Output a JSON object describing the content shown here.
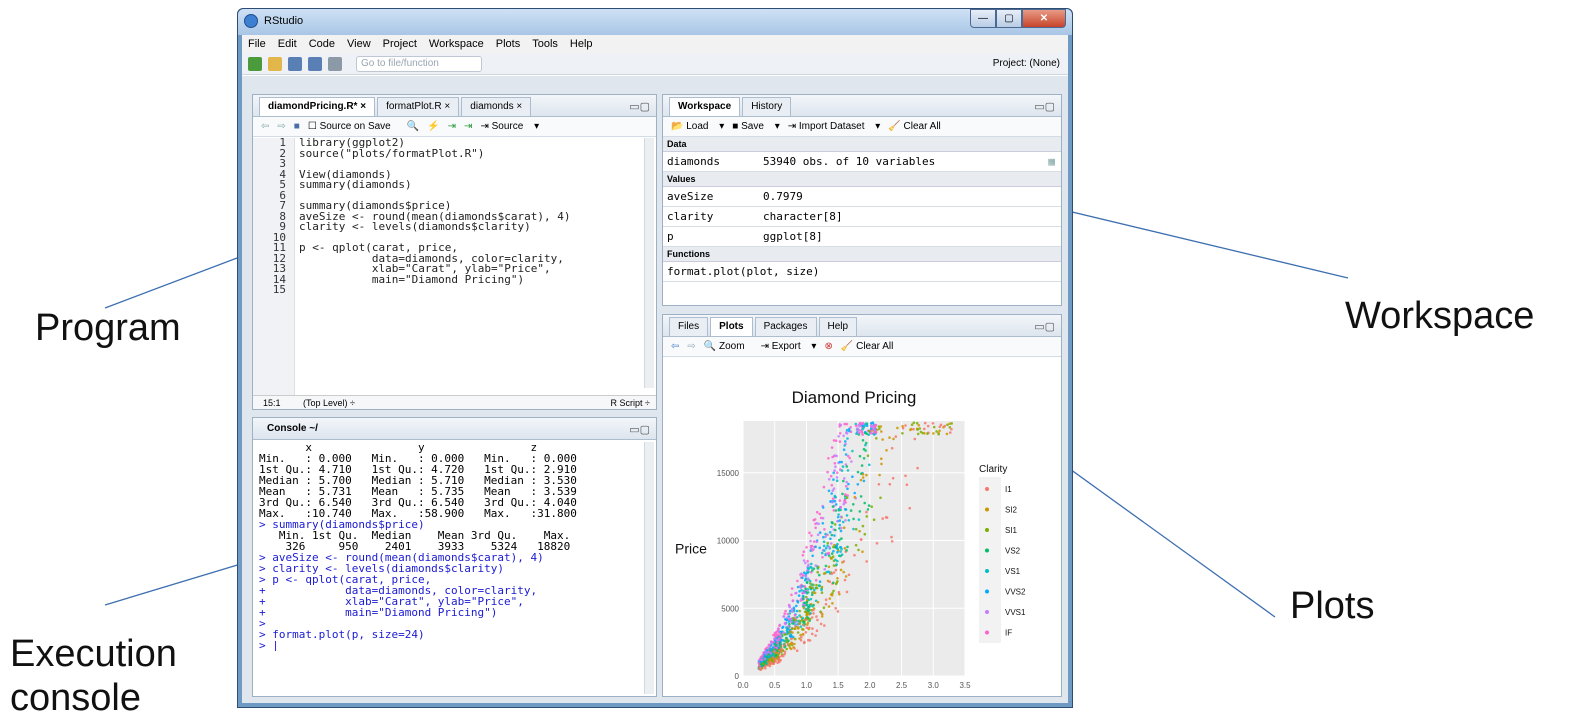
{
  "callouts": {
    "program": "Program",
    "workspace": "Workspace",
    "console": "Execution console",
    "plots": "Plots"
  },
  "window": {
    "title": "RStudio",
    "min": "—",
    "max": "▢",
    "close": "✕"
  },
  "menu": [
    "File",
    "Edit",
    "Code",
    "View",
    "Project",
    "Workspace",
    "Plots",
    "Tools",
    "Help"
  ],
  "toolbar": {
    "goto_placeholder": "Go to file/function",
    "project": "Project: (None)"
  },
  "editor": {
    "tabs": [
      "diamondPricing.R*",
      "formatPlot.R",
      "diamonds"
    ],
    "source_on_save": "Source on Save",
    "source_btn": "Source",
    "line_numbers": [
      "1",
      "2",
      "3",
      "4",
      "5",
      "6",
      "7",
      "8",
      "9",
      "10",
      "11",
      "12",
      "13",
      "14",
      "15"
    ],
    "lines": [
      "library(ggplot2)",
      "source(\"plots/formatPlot.R\")",
      "",
      "View(diamonds)",
      "summary(diamonds)",
      "",
      "summary(diamonds$price)",
      "aveSize <- round(mean(diamonds$carat), 4)",
      "clarity <- levels(diamonds$clarity)",
      "",
      "p <- qplot(carat, price,",
      "           data=diamonds, color=clarity,",
      "           xlab=\"Carat\", ylab=\"Price\",",
      "           main=\"Diamond Pricing\")",
      ""
    ],
    "status_pos": "15:1",
    "status_level": "(Top Level) ÷",
    "status_type": "R Script ÷"
  },
  "console": {
    "title": "Console ~/",
    "lines": [
      {
        "t": "       x                y                z",
        "c": "out"
      },
      {
        "t": "Min.   : 0.000   Min.   : 0.000   Min.   : 0.000",
        "c": "out"
      },
      {
        "t": "1st Qu.: 4.710   1st Qu.: 4.720   1st Qu.: 2.910",
        "c": "out"
      },
      {
        "t": "Median : 5.700   Median : 5.710   Median : 3.530",
        "c": "out"
      },
      {
        "t": "Mean   : 5.731   Mean   : 5.735   Mean   : 3.539",
        "c": "out"
      },
      {
        "t": "3rd Qu.: 6.540   3rd Qu.: 6.540   3rd Qu.: 4.040",
        "c": "out"
      },
      {
        "t": "Max.   :10.740   Max.   :58.900   Max.   :31.800",
        "c": "out"
      },
      {
        "t": "> summary(diamonds$price)",
        "c": "in"
      },
      {
        "t": "   Min. 1st Qu.  Median    Mean 3rd Qu.    Max.",
        "c": "out"
      },
      {
        "t": "    326     950    2401    3933    5324   18820",
        "c": "out"
      },
      {
        "t": "> aveSize <- round(mean(diamonds$carat), 4)",
        "c": "in"
      },
      {
        "t": "> clarity <- levels(diamonds$clarity)",
        "c": "in"
      },
      {
        "t": "> p <- qplot(carat, price,",
        "c": "in"
      },
      {
        "t": "+            data=diamonds, color=clarity,",
        "c": "in"
      },
      {
        "t": "+            xlab=\"Carat\", ylab=\"Price\",",
        "c": "in"
      },
      {
        "t": "+            main=\"Diamond Pricing\")",
        "c": "in"
      },
      {
        "t": ">",
        "c": "in"
      },
      {
        "t": "> format.plot(p, size=24)",
        "c": "in"
      },
      {
        "t": "> |",
        "c": "in"
      }
    ]
  },
  "workspace": {
    "tabs": [
      "Workspace",
      "History"
    ],
    "load": "Load",
    "save": "Save",
    "import": "Import Dataset",
    "clear": "Clear All",
    "sections": {
      "data": "Data",
      "values": "Values",
      "functions": "Functions"
    },
    "data_rows": [
      {
        "k": "diamonds",
        "v": "53940 obs. of 10 variables"
      }
    ],
    "value_rows": [
      {
        "k": "aveSize",
        "v": "0.7979"
      },
      {
        "k": "clarity",
        "v": "character[8]"
      },
      {
        "k": "p",
        "v": "ggplot[8]"
      }
    ],
    "function_rows": [
      {
        "k": "format.plot(plot, size)"
      }
    ]
  },
  "plots": {
    "tabs": [
      "Files",
      "Plots",
      "Packages",
      "Help"
    ],
    "zoom": "Zoom",
    "export": "Export",
    "clear": "Clear All"
  },
  "chart_data": {
    "type": "scatter",
    "title": "Diamond Pricing",
    "xlabel": "Carat",
    "ylabel": "Price",
    "xlim": [
      0,
      3.5
    ],
    "ylim": [
      0,
      18820
    ],
    "xticks": [
      "0.0",
      "0.5",
      "1.0",
      "1.5",
      "2.0",
      "2.5",
      "3.0",
      "3.5"
    ],
    "yticks": [
      "0",
      "5000",
      "10000",
      "15000"
    ],
    "legend_title": "Clarity",
    "legend_placement": "right",
    "series": [
      {
        "name": "I1",
        "color": "#f8766d"
      },
      {
        "name": "SI2",
        "color": "#cd9600"
      },
      {
        "name": "SI1",
        "color": "#7cae00"
      },
      {
        "name": "VS2",
        "color": "#00be67"
      },
      {
        "name": "VS1",
        "color": "#00bfc4"
      },
      {
        "name": "VVS2",
        "color": "#00a9ff"
      },
      {
        "name": "VVS1",
        "color": "#c77cff"
      },
      {
        "name": "IF",
        "color": "#ff61cc"
      }
    ]
  }
}
